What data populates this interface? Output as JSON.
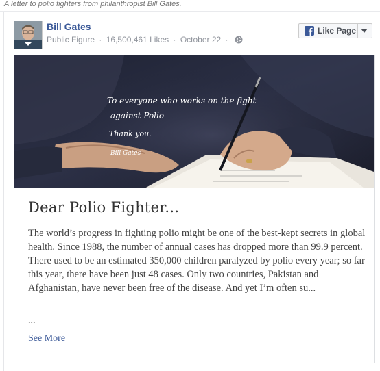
{
  "caption": "A letter to polio fighters from philanthropist Bill Gates.",
  "post": {
    "page_name": "Bill Gates",
    "category": "Public Figure",
    "likes": "16,500,461 Likes",
    "date": "October 22",
    "separator": "·",
    "privacy_icon": "globe-icon",
    "avatar_icon": "profile-photo"
  },
  "like_button": {
    "label": "Like Page",
    "icon": "facebook-logo-icon",
    "dropdown_icon": "caret-down-icon",
    "brand_color": "#3b5998"
  },
  "article": {
    "image_handwriting": [
      "To everyone who works on the fight",
      "against Polio",
      "Thank you.",
      "Bill Gates"
    ],
    "title": "Dear Polio Fighter...",
    "body": "The world’s progress in fighting polio might be one of the best-kept secrets in global health. Since 1988, the number of annual cases has dropped more than 99.9 percent. There used to be an estimated 350,000 children paralyzed by polio every year; so far this year, there have been just 48 cases. Only two countries, Pakistan and Afghanistan, have never been free of the disease. And yet I’m often su...",
    "ellipsis": "...",
    "see_more": "See More"
  }
}
